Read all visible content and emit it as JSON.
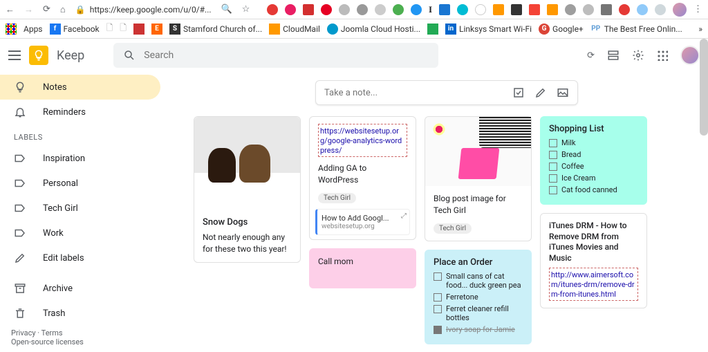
{
  "chrome": {
    "url": "https://keep.google.com/u/0/#..."
  },
  "bookmarks": [
    "Apps",
    "Facebook",
    "",
    "",
    "",
    "",
    "Stamford Church of...",
    "CloudMail",
    "Joomla Cloud Hosti...",
    "",
    "",
    "Linksys Smart Wi-Fi",
    "Google+",
    "The Best Free Onlin..."
  ],
  "brand": "Keep",
  "search": {
    "placeholder": "Search"
  },
  "take_note": "Take a note...",
  "sidebar": {
    "items": [
      {
        "label": "Notes",
        "active": true
      },
      {
        "label": "Reminders"
      }
    ],
    "labels_header": "LABELS",
    "labels": [
      "Inspiration",
      "Personal",
      "Tech Girl",
      "Work"
    ],
    "edit": "Edit labels",
    "archive": "Archive",
    "trash": "Trash",
    "footer": {
      "privacy": "Privacy",
      "terms": "Terms",
      "oss": "Open-source licenses"
    }
  },
  "notes": {
    "snow": {
      "title": "Snow Dogs",
      "body": "Not nearly enough any for these two this year!"
    },
    "ga": {
      "link": "https://websitesetup.org/google-analytics-wordpress/",
      "body": "Adding GA to WordPress",
      "label": "Tech Girl",
      "attach_title": "How to Add Googl...",
      "attach_domain": "websitesetup.org"
    },
    "call": {
      "body": "Call mom"
    },
    "blog": {
      "body": "Blog post image for Tech Girl",
      "label": "Tech Girl"
    },
    "order": {
      "title": "Place an Order",
      "items": [
        "Small cans of cat food... duck green pea",
        "Ferretone",
        "Ferret cleaner refill bottles"
      ],
      "done": "Ivory soap for Jamie"
    },
    "shop": {
      "title": "Shopping List",
      "items": [
        "Milk",
        "Bread",
        "Coffee",
        "Ice Cream",
        "Cat food canned"
      ]
    },
    "drm": {
      "title": "iTunes DRM - How to Remove DRM from iTunes Movies and Music",
      "link": "http://www.aimersoft.com/itunes-drm/remove-drm-from-itunes.html"
    }
  }
}
